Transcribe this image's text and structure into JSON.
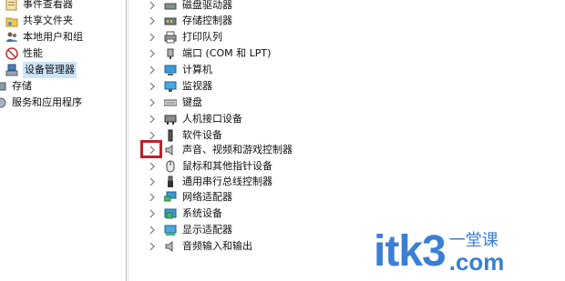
{
  "left_nav": {
    "items": [
      {
        "label": "事件查看器",
        "icon": "event-viewer-icon"
      },
      {
        "label": "共享文件夹",
        "icon": "shared-folder-icon"
      },
      {
        "label": "本地用户和组",
        "icon": "users-icon"
      },
      {
        "label": "性能",
        "icon": "performance-icon"
      },
      {
        "label": "设备管理器",
        "icon": "device-manager-icon",
        "selected": true
      },
      {
        "label": "存储",
        "icon": "storage-icon"
      },
      {
        "label": "服务和应用程序",
        "icon": "services-icon"
      }
    ]
  },
  "device_tree": {
    "items": [
      {
        "label": "磁盘驱动器",
        "icon": "disk-drive-icon"
      },
      {
        "label": "存储控制器",
        "icon": "storage-controller-icon"
      },
      {
        "label": "打印队列",
        "icon": "printer-icon"
      },
      {
        "label": "端口 (COM 和 LPT)",
        "icon": "port-icon"
      },
      {
        "label": "计算机",
        "icon": "computer-icon"
      },
      {
        "label": "监视器",
        "icon": "monitor-icon"
      },
      {
        "label": "键盘",
        "icon": "keyboard-icon"
      },
      {
        "label": "人机接口设备",
        "icon": "hid-icon"
      },
      {
        "label": "软件设备",
        "icon": "software-device-icon"
      },
      {
        "label": "声音、视频和游戏控制器",
        "icon": "speaker-icon",
        "highlighted": true
      },
      {
        "label": "鼠标和其他指针设备",
        "icon": "mouse-icon"
      },
      {
        "label": "通用串行总线控制器",
        "icon": "usb-icon"
      },
      {
        "label": "网络适配器",
        "icon": "network-adapter-icon"
      },
      {
        "label": "系统设备",
        "icon": "system-device-icon"
      },
      {
        "label": "显示适配器",
        "icon": "display-adapter-icon"
      },
      {
        "label": "音频输入和输出",
        "icon": "audio-io-icon"
      }
    ]
  },
  "watermark": {
    "main": "itk3",
    "cn": "一堂课",
    "domain": ".com"
  },
  "colors": {
    "highlight": "#c0202a",
    "selection": "#cce4f7",
    "watermark": "#3a7fd5"
  }
}
